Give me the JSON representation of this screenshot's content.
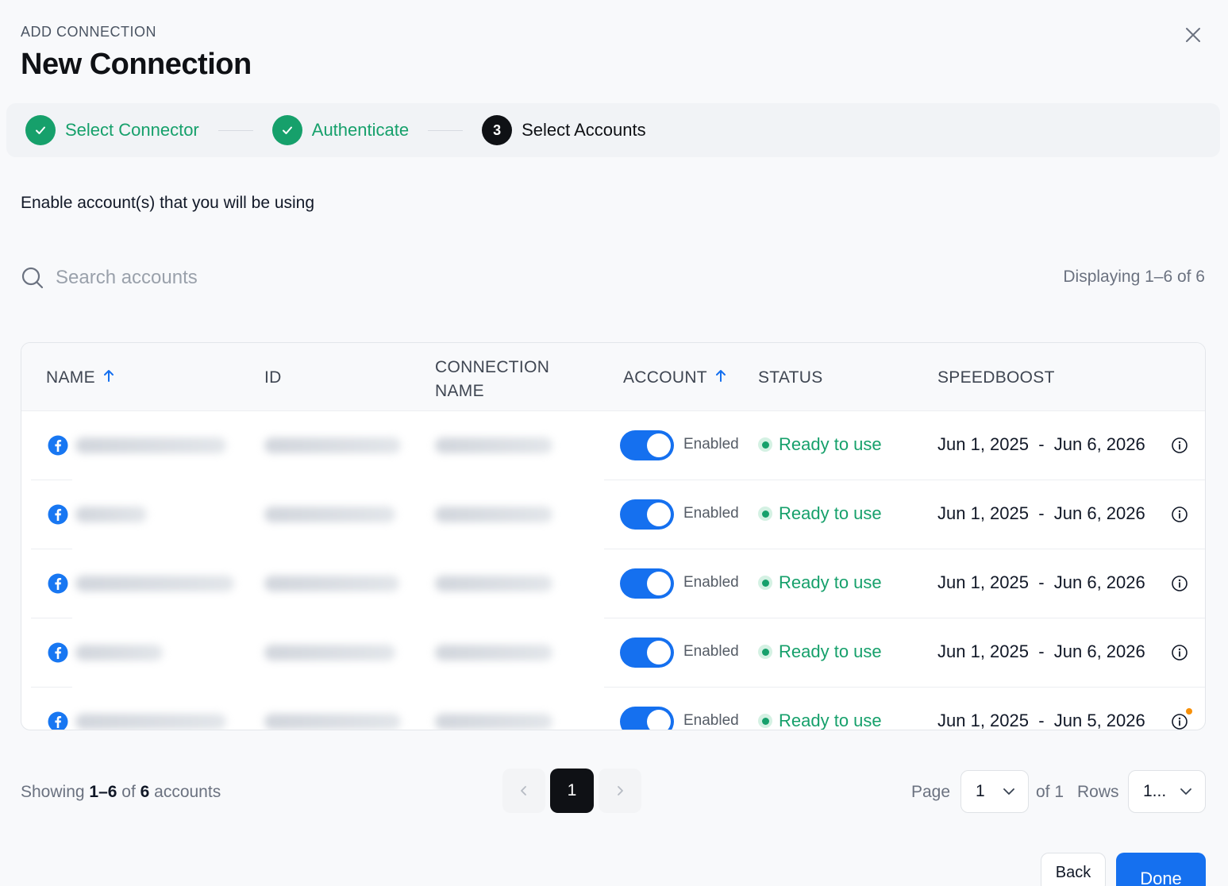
{
  "header": {
    "eyebrow": "ADD CONNECTION",
    "title": "New Connection"
  },
  "stepper": {
    "steps": [
      {
        "label": "Select Connector",
        "state": "done"
      },
      {
        "label": "Authenticate",
        "state": "done"
      },
      {
        "label": "Select Accounts",
        "state": "active",
        "number": "3"
      }
    ]
  },
  "subtitle": "Enable account(s) that you will be using",
  "search": {
    "placeholder": "Search accounts",
    "value": ""
  },
  "displaying": "Displaying 1–6 of 6",
  "table": {
    "columns": {
      "name": "NAME",
      "id": "ID",
      "connection_line1": "CONNECTION",
      "connection_line2": "NAME",
      "account": "ACCOUNT",
      "status": "STATUS",
      "speedboost": "SPEEDBOOST"
    },
    "rows": [
      {
        "toggle_label": "Enabled",
        "enabled": true,
        "status": "Ready to use",
        "speedboost": "Jun 1, 2025  -  Jun 6, 2026"
      },
      {
        "toggle_label": "Enabled",
        "enabled": true,
        "status": "Ready to use",
        "speedboost": "Jun 1, 2025  -  Jun 6, 2026"
      },
      {
        "toggle_label": "Enabled",
        "enabled": true,
        "status": "Ready to use",
        "speedboost": "Jun 1, 2025  -  Jun 6, 2026"
      },
      {
        "toggle_label": "Enabled",
        "enabled": true,
        "status": "Ready to use",
        "speedboost": "Jun 1, 2025  -  Jun 6, 2026"
      },
      {
        "toggle_label": "Enabled",
        "enabled": true,
        "status": "Ready to use",
        "speedboost": "Jun 1, 2025  -  Jun 5, 2026"
      }
    ]
  },
  "footer": {
    "showing_prefix": "Showing ",
    "showing_range": "1–6",
    "showing_of": " of ",
    "showing_total": "6",
    "showing_suffix": " accounts",
    "current_page": "1",
    "page_label": "Page",
    "page_select": "1",
    "of_pages": "of 1",
    "rows_label": "Rows",
    "rows_select": "1..."
  },
  "actions": {
    "back": "Back",
    "done": "Done"
  },
  "colors": {
    "accent": "#1570ef",
    "success": "#16a06b",
    "dark": "#0f1115",
    "facebook": "#1877f2"
  }
}
